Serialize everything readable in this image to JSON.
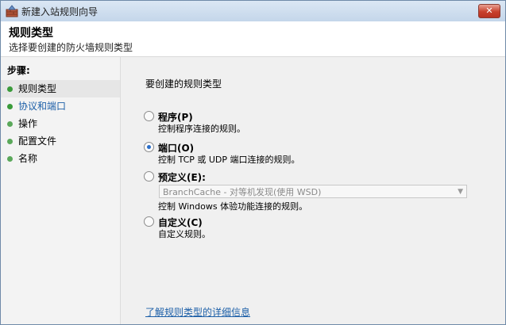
{
  "window": {
    "title": "新建入站规则向导",
    "close_glyph": "✕"
  },
  "header": {
    "title": "规则类型",
    "subtitle": "选择要创建的防火墙规则类型"
  },
  "sidebar": {
    "heading": "步骤:",
    "items": [
      {
        "label": "规则类型"
      },
      {
        "label": "协议和端口"
      },
      {
        "label": "操作"
      },
      {
        "label": "配置文件"
      },
      {
        "label": "名称"
      }
    ]
  },
  "content": {
    "prompt": "要创建的规则类型",
    "options": [
      {
        "label": "程序(P)",
        "desc": "控制程序连接的规则。",
        "checked": false
      },
      {
        "label": "端口(O)",
        "desc": "控制 TCP 或 UDP 端口连接的规则。",
        "checked": true
      },
      {
        "label": "预定义(E):",
        "dropdown": "BranchCache - 对等机发现(使用 WSD)",
        "desc": "控制 Windows 体验功能连接的规则。",
        "checked": false
      },
      {
        "label": "自定义(C)",
        "desc": "自定义规则。",
        "checked": false
      }
    ],
    "more_link": "了解规则类型的详细信息"
  }
}
